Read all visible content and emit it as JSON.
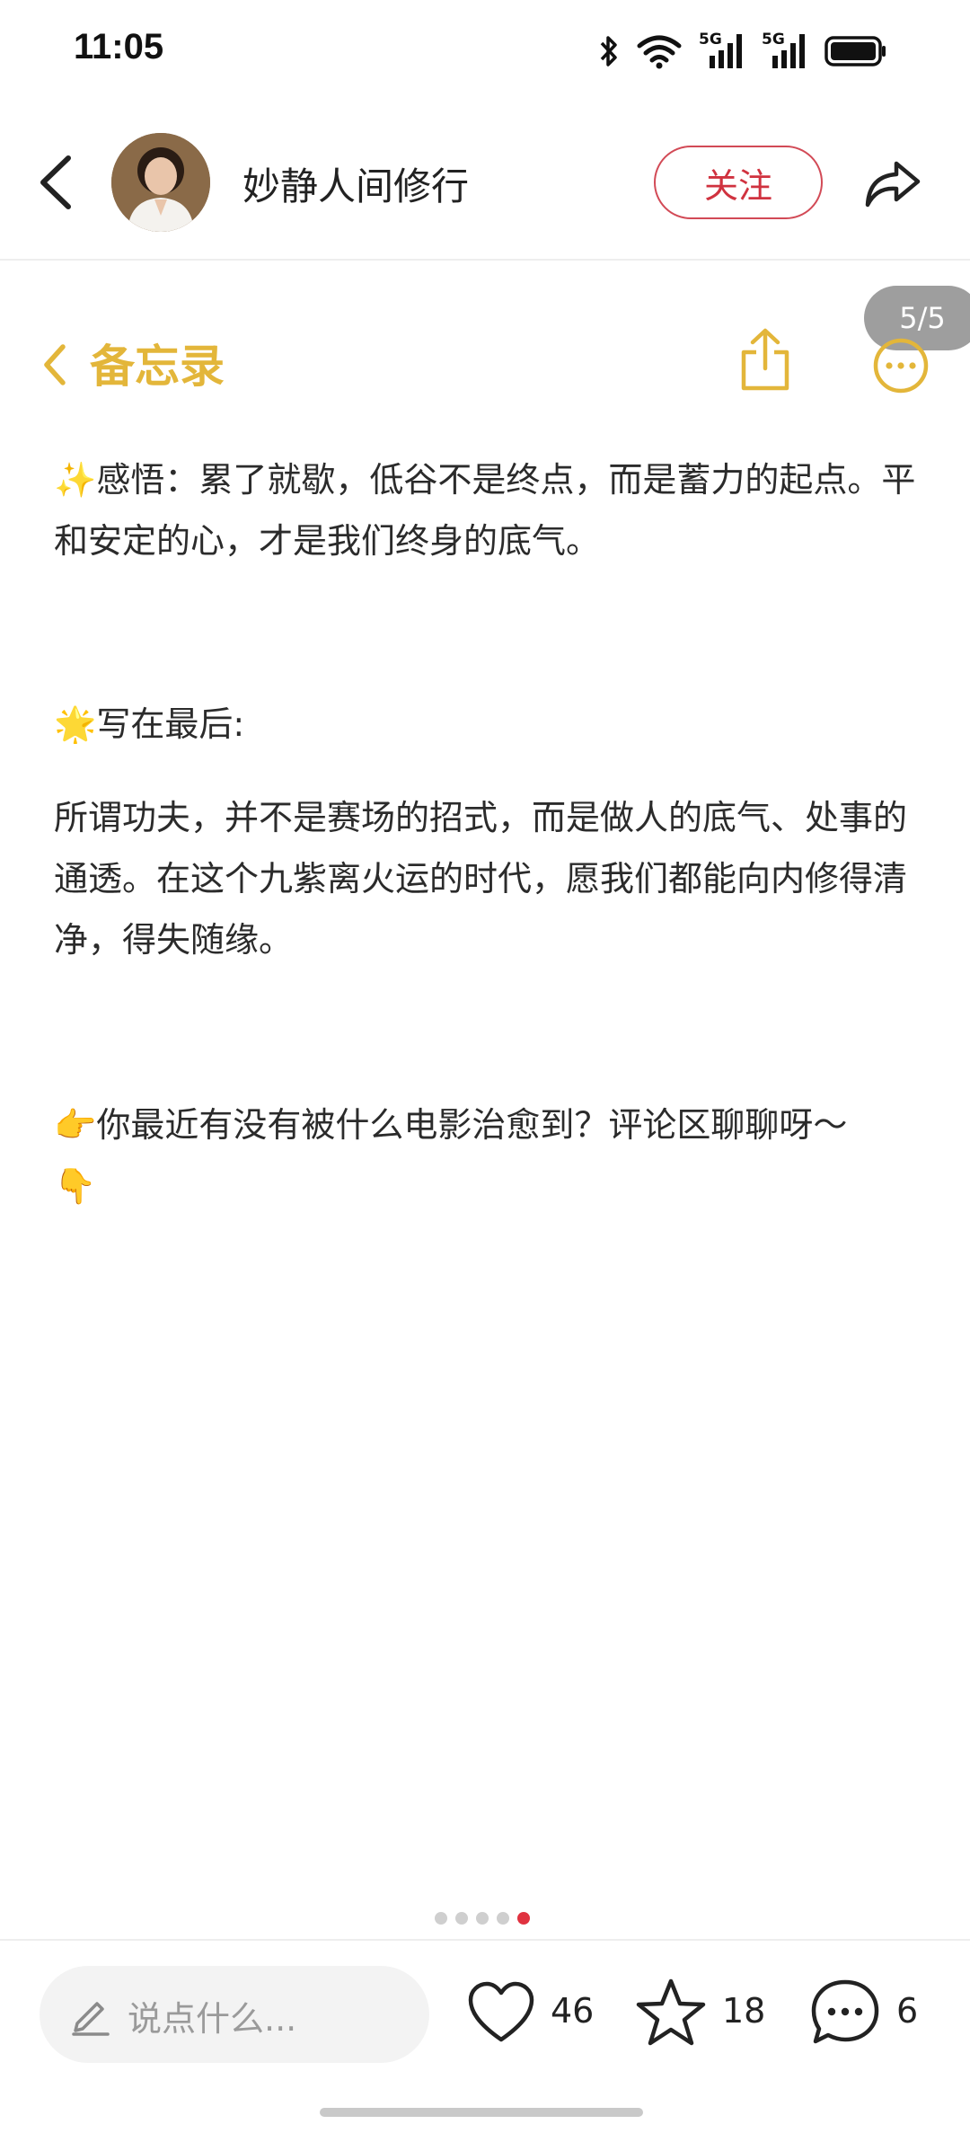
{
  "status_bar": {
    "time": "11:05",
    "icons": [
      "bluetooth-icon",
      "wifi-icon",
      "signal-5g-icon",
      "signal-5g-icon",
      "battery-icon"
    ],
    "network_label_1": "5G",
    "network_label_2": "5G"
  },
  "header": {
    "author_name": "妙静人间修行",
    "follow_label": "关注"
  },
  "page_counter": "5/5",
  "notes": {
    "title": "备忘录",
    "accent_color": "#e3b63a"
  },
  "content": {
    "p1_emoji": "✨",
    "p1_text": "感悟：累了就歇，低谷不是终点，而是蓄力的起点。平和安定的心，才是我们终身的底气。",
    "p2_emoji": "🌟",
    "p2_text": "写在最后:",
    "p3_text": "所谓功夫，并不是赛场的招式，而是做人的底气、处事的通透。在这个九紫离火运的时代，愿我们都能向内修得清净，得失随缘。",
    "p4_emoji": "👉",
    "p4_text": "你最近有没有被什么电影治愈到？评论区聊聊呀～",
    "p4_tail_emoji": "👇"
  },
  "pager": {
    "total": 5,
    "active_index": 4
  },
  "bottom_bar": {
    "comment_placeholder": "说点什么...",
    "likes": "46",
    "favorites": "18",
    "comments": "6"
  },
  "colors": {
    "follow": "#d0323f",
    "active_dot": "#e03240"
  }
}
